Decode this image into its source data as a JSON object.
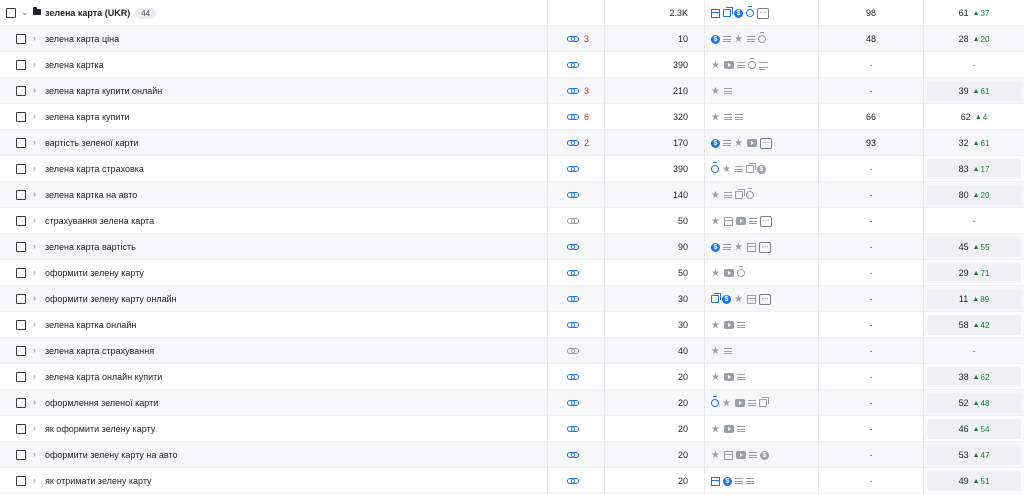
{
  "group": {
    "name": "зелена карта (UKR)",
    "count": "44",
    "volume": "2.3K",
    "serp": [
      "table-blue",
      "images-blue",
      "dollar",
      "timer-blue",
      "more"
    ],
    "pos1": "98",
    "pos2": "61",
    "delta": "37"
  },
  "rows": [
    {
      "kw": "зелена карта ціна",
      "link": "blue",
      "lcount": "3",
      "vol": "10",
      "serp": [
        "dollar",
        "lines",
        "star",
        "lines",
        "timer"
      ],
      "pos1": "48",
      "pos2": "28",
      "delta": "20",
      "box": false
    },
    {
      "kw": "зелена картка",
      "link": "blue",
      "lcount": "",
      "vol": "390",
      "serp": [
        "star",
        "video",
        "lines",
        "timer",
        "list"
      ],
      "pos1": "-",
      "pos2": "-",
      "delta": "",
      "box": false
    },
    {
      "kw": "зелена карта купити онлайн",
      "link": "blue",
      "lcount": "3",
      "vol": "210",
      "serp": [
        "star",
        "lines"
      ],
      "pos1": "-",
      "pos2": "39",
      "delta": "61",
      "box": true
    },
    {
      "kw": "зелена карта купити",
      "link": "blue",
      "lcount": "6",
      "vol": "320",
      "serp": [
        "star",
        "lines",
        "lines"
      ],
      "pos1": "66",
      "pos2": "62",
      "delta": "4",
      "box": false
    },
    {
      "kw": "вартість зеленої карти",
      "link": "blue",
      "lcount": "2",
      "vol": "170",
      "serp": [
        "dollar",
        "lines",
        "star",
        "video",
        "more"
      ],
      "pos1": "93",
      "pos2": "32",
      "delta": "61",
      "box": false
    },
    {
      "kw": "зелена карта страховка",
      "link": "blue",
      "lcount": "",
      "vol": "390",
      "serp": [
        "timer-blue",
        "star",
        "lines",
        "images",
        "dollar-grey"
      ],
      "pos1": "-",
      "pos2": "83",
      "delta": "17",
      "box": true
    },
    {
      "kw": "зелена картка на авто",
      "link": "blue",
      "lcount": "",
      "vol": "140",
      "serp": [
        "star",
        "lines",
        "images",
        "timer"
      ],
      "pos1": "-",
      "pos2": "80",
      "delta": "20",
      "box": true
    },
    {
      "kw": "страхування зелена карта",
      "link": "grey",
      "lcount": "",
      "vol": "50",
      "serp": [
        "star",
        "table",
        "video",
        "lines",
        "more"
      ],
      "pos1": "-",
      "pos2": "-",
      "delta": "",
      "box": false
    },
    {
      "kw": "зелена карта вартість",
      "link": "blue",
      "lcount": "",
      "vol": "90",
      "serp": [
        "dollar",
        "lines",
        "star",
        "table",
        "more"
      ],
      "pos1": "-",
      "pos2": "45",
      "delta": "55",
      "box": true
    },
    {
      "kw": "оформити зелену карту",
      "link": "blue",
      "lcount": "",
      "vol": "50",
      "serp": [
        "star",
        "video",
        "timer"
      ],
      "pos1": "-",
      "pos2": "29",
      "delta": "71",
      "box": true
    },
    {
      "kw": "оформити зелену карту онлайн",
      "link": "blue",
      "lcount": "",
      "vol": "30",
      "serp": [
        "images-blue",
        "dollar",
        "star",
        "table",
        "more"
      ],
      "pos1": "-",
      "pos2": "11",
      "delta": "89",
      "box": true
    },
    {
      "kw": "зелена картка онлайн",
      "link": "blue",
      "lcount": "",
      "vol": "30",
      "serp": [
        "star",
        "video",
        "lines"
      ],
      "pos1": "-",
      "pos2": "58",
      "delta": "42",
      "box": true
    },
    {
      "kw": "зелена карта страхування",
      "link": "grey",
      "lcount": "",
      "vol": "40",
      "serp": [
        "star",
        "lines"
      ],
      "pos1": "-",
      "pos2": "-",
      "delta": "",
      "box": false
    },
    {
      "kw": "зелена карта онлайн купити",
      "link": "blue",
      "lcount": "",
      "vol": "20",
      "serp": [
        "star",
        "video",
        "lines"
      ],
      "pos1": "-",
      "pos2": "38",
      "delta": "62",
      "box": true
    },
    {
      "kw": "оформлення зеленої карти",
      "link": "blue",
      "lcount": "",
      "vol": "20",
      "serp": [
        "timer-blue",
        "star",
        "video",
        "lines",
        "images"
      ],
      "pos1": "-",
      "pos2": "52",
      "delta": "48",
      "box": true
    },
    {
      "kw": "як оформити зелену карту",
      "link": "blue",
      "lcount": "",
      "vol": "20",
      "serp": [
        "star",
        "video",
        "lines"
      ],
      "pos1": "-",
      "pos2": "46",
      "delta": "54",
      "box": true
    },
    {
      "kw": "оформити зелену карту на авто",
      "link": "blue",
      "lcount": "",
      "vol": "20",
      "serp": [
        "star",
        "table",
        "video",
        "lines",
        "dollar-grey"
      ],
      "pos1": "-",
      "pos2": "53",
      "delta": "47",
      "box": true
    },
    {
      "kw": "як отримати зелену карту",
      "link": "blue",
      "lcount": "",
      "vol": "20",
      "serp": [
        "table-blue",
        "dollar",
        "lines",
        "lines"
      ],
      "pos1": "-",
      "pos2": "49",
      "delta": "51",
      "box": true
    }
  ]
}
